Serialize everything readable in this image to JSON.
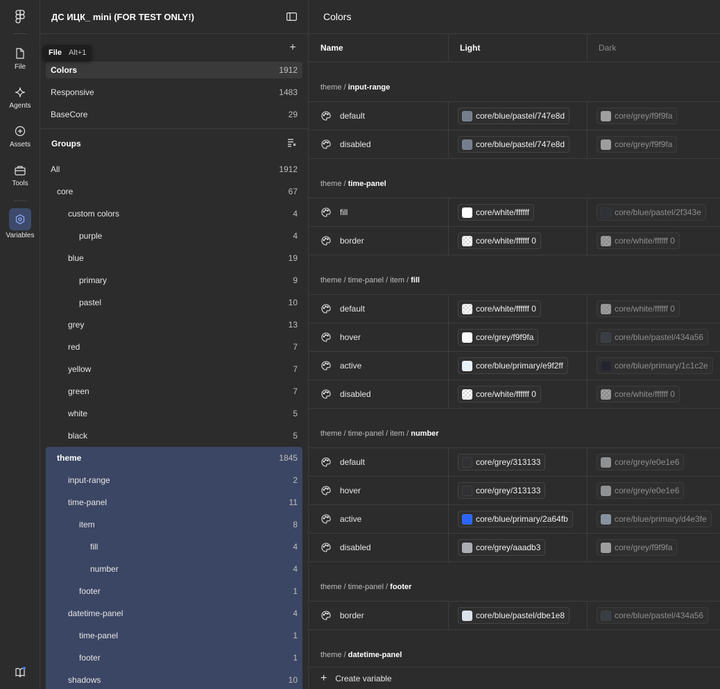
{
  "rail": {
    "items": [
      {
        "label": "File",
        "icon": "file-icon"
      },
      {
        "label": "Agents",
        "icon": "agents-icon"
      },
      {
        "label": "Assets",
        "icon": "assets-icon"
      },
      {
        "label": "Tools",
        "icon": "tools-icon"
      },
      {
        "label": "Variables",
        "icon": "variables-icon",
        "active": true
      }
    ]
  },
  "tooltip": {
    "label": "File",
    "shortcut": "Alt+1"
  },
  "sidebar": {
    "title": "ДС ИЦК_ mini (FOR TEST ONLY!)",
    "collections": [
      {
        "name": "Colors",
        "count": "1912",
        "selected": true
      },
      {
        "name": "Responsive",
        "count": "1483"
      },
      {
        "name": "BaseCore",
        "count": "29"
      }
    ],
    "groups_title": "Groups",
    "groups": [
      {
        "name": "All",
        "count": "1912",
        "level": 0
      },
      {
        "name": "core",
        "count": "67",
        "level": 1
      },
      {
        "name": "custom colors",
        "count": "4",
        "level": 2
      },
      {
        "name": "purple",
        "count": "4",
        "level": 3
      },
      {
        "name": "blue",
        "count": "19",
        "level": 2
      },
      {
        "name": "primary",
        "count": "9",
        "level": 3
      },
      {
        "name": "pastel",
        "count": "10",
        "level": 3
      },
      {
        "name": "grey",
        "count": "13",
        "level": 2
      },
      {
        "name": "red",
        "count": "7",
        "level": 2
      },
      {
        "name": "yellow",
        "count": "7",
        "level": 2
      },
      {
        "name": "green",
        "count": "7",
        "level": 2
      },
      {
        "name": "white",
        "count": "5",
        "level": 2
      },
      {
        "name": "black",
        "count": "5",
        "level": 2
      },
      {
        "name": "theme",
        "count": "1845",
        "level": 1,
        "hl": true,
        "bold": true
      },
      {
        "name": "input-range",
        "count": "2",
        "level": 2,
        "hl": true
      },
      {
        "name": "time-panel",
        "count": "11",
        "level": 2,
        "hl": true
      },
      {
        "name": "item",
        "count": "8",
        "level": 3,
        "hl": true
      },
      {
        "name": "fill",
        "count": "4",
        "level": 4,
        "hl": true
      },
      {
        "name": "number",
        "count": "4",
        "level": 4,
        "hl": true
      },
      {
        "name": "footer",
        "count": "1",
        "level": 3,
        "hl": true
      },
      {
        "name": "datetime-panel",
        "count": "4",
        "level": 2,
        "hl": true
      },
      {
        "name": "time-panel",
        "count": "1",
        "level": 3,
        "hl": true
      },
      {
        "name": "footer",
        "count": "1",
        "level": 3,
        "hl": true
      },
      {
        "name": "shadows",
        "count": "10",
        "level": 2,
        "hl": true
      }
    ]
  },
  "main": {
    "title": "Colors",
    "columns": {
      "name": "Name",
      "light": "Light",
      "dark": "Dark"
    },
    "sections": [
      {
        "path": "theme / ",
        "leaf": "input-range",
        "rows": [
          {
            "name": "default",
            "light": {
              "label": "core/blue/pastel/747e8d",
              "color": "#747e8d"
            },
            "dark": {
              "label": "core/grey/f9f9fa",
              "color": "#f9f9fa"
            }
          },
          {
            "name": "disabled",
            "light": {
              "label": "core/blue/pastel/747e8d",
              "color": "#747e8d"
            },
            "dark": {
              "label": "core/grey/f9f9fa",
              "color": "#f9f9fa"
            }
          }
        ]
      },
      {
        "path": "theme / ",
        "leaf": "time-panel",
        "rows": [
          {
            "name": "fill",
            "light": {
              "label": "core/white/ffffff",
              "color": "#ffffff"
            },
            "dark": {
              "label": "core/blue/pastel/2f343e",
              "color": "#2f343e"
            }
          },
          {
            "name": "border",
            "light": {
              "label": "core/white/ffffff 0",
              "color": "checker"
            },
            "dark": {
              "label": "core/white/ffffff 0",
              "color": "checker"
            }
          }
        ]
      },
      {
        "path": "theme / time-panel / item / ",
        "leaf": "fill",
        "rows": [
          {
            "name": "default",
            "light": {
              "label": "core/white/ffffff 0",
              "color": "checker"
            },
            "dark": {
              "label": "core/white/ffffff 0",
              "color": "checker"
            }
          },
          {
            "name": "hover",
            "light": {
              "label": "core/grey/f9f9fa",
              "color": "#f9f9fa"
            },
            "dark": {
              "label": "core/blue/pastel/434a56",
              "color": "#434a56"
            }
          },
          {
            "name": "active",
            "light": {
              "label": "core/blue/primary/e9f2ff",
              "color": "#e9f2ff"
            },
            "dark": {
              "label": "core/blue/primary/1c1c2e",
              "color": "#1c1c2e"
            }
          },
          {
            "name": "disabled",
            "light": {
              "label": "core/white/ffffff 0",
              "color": "checker"
            },
            "dark": {
              "label": "core/white/ffffff 0",
              "color": "checker"
            }
          }
        ]
      },
      {
        "path": "theme / time-panel / item / ",
        "leaf": "number",
        "rows": [
          {
            "name": "default",
            "light": {
              "label": "core/grey/313133",
              "color": "#313133"
            },
            "dark": {
              "label": "core/grey/e0e1e6",
              "color": "#e0e1e6"
            }
          },
          {
            "name": "hover",
            "light": {
              "label": "core/grey/313133",
              "color": "#313133"
            },
            "dark": {
              "label": "core/grey/e0e1e6",
              "color": "#e0e1e6"
            }
          },
          {
            "name": "active",
            "light": {
              "label": "core/blue/primary/2a64fb",
              "color": "#2a64fb"
            },
            "dark": {
              "label": "core/blue/primary/d4e3fe",
              "color": "#d4e3fe"
            }
          },
          {
            "name": "disabled",
            "light": {
              "label": "core/grey/aaadb3",
              "color": "#aaadb3"
            },
            "dark": {
              "label": "core/grey/f9f9fa",
              "color": "#f9f9fa"
            }
          }
        ]
      },
      {
        "path": "theme / time-panel / ",
        "leaf": "footer",
        "rows": [
          {
            "name": "border",
            "light": {
              "label": "core/blue/pastel/dbe1e8",
              "color": "#dbe1e8"
            },
            "dark": {
              "label": "core/blue/pastel/434a56",
              "color": "#434a56"
            }
          }
        ]
      },
      {
        "path": "theme / ",
        "leaf": "datetime-panel",
        "rows": []
      }
    ],
    "create_label": "Create variable"
  }
}
